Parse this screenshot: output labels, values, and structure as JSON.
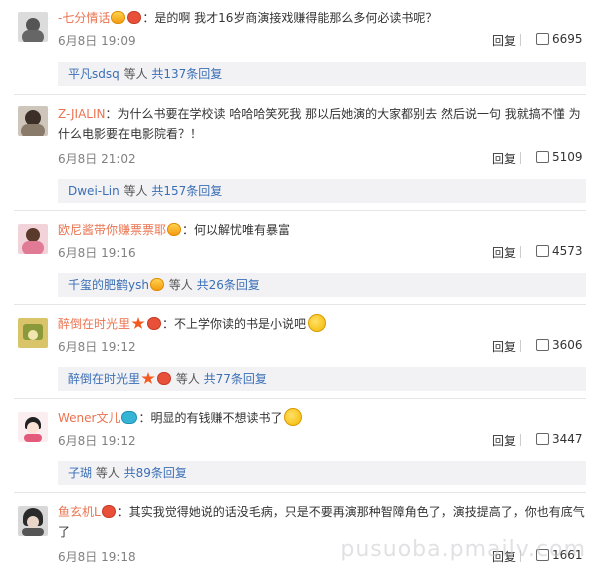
{
  "comments": [
    {
      "user": "-七分情话",
      "text": "：是的啊 我才16岁商演接戏赚得能那么多何必读书呢？",
      "date": "6月8日 19:09",
      "reply": "回复",
      "likes": "6695",
      "sub": {
        "user": "平凡sdsq",
        "mid": " 等人 ",
        "count": "共137条回复"
      },
      "avatar_color": "#e8e8e8"
    },
    {
      "user": "Z-JIALIN",
      "text": "：为什么书要在学校读 哈哈哈笑死我  那以后她演的大家都别去 然后说一句 我就搞不懂  为什么电影要在电影院看？！",
      "date": "6月8日 21:02",
      "reply": "回复",
      "likes": "5109",
      "sub": {
        "user": "Dwei-Lin",
        "mid": " 等人 ",
        "count": "共157条回复"
      },
      "avatar_color": "#7a6a5c"
    },
    {
      "user": "欧尼酱带你赚票票耶",
      "text": "：何以解忧唯有暴富",
      "date": "6月8日 19:16",
      "reply": "回复",
      "likes": "4573",
      "sub": {
        "user": "千玺的肥鹤ysh",
        "mid": " 等人 ",
        "count": "共26条回复"
      },
      "avatar_color": "#e9a6b4"
    },
    {
      "user": "醉倒在时光里",
      "text": "：不上学你读的书是小说吧",
      "date": "6月8日 19:12",
      "reply": "回复",
      "likes": "3606",
      "sub": {
        "user": "醉倒在时光里",
        "mid": " 等人 ",
        "count": "共77条回复"
      },
      "avatar_color": "#c6b25a"
    },
    {
      "user": "Wener文儿",
      "text": "：明显的有钱赚不想读书了",
      "date": "6月8日 19:12",
      "reply": "回复",
      "likes": "3447",
      "sub": {
        "user": "子瑚",
        "mid": " 等人 ",
        "count": "共89条回复"
      },
      "avatar_color": "#f4e0e4"
    },
    {
      "user": "鱼玄机L",
      "text": "：其实我觉得她说的话没毛病，只是不要再演那种智障角色了，演技提高了，你也有底气了",
      "date": "6月8日 19:18",
      "reply": "回复",
      "likes": "1661",
      "avatar_color": "#4a4a4a"
    }
  ],
  "watermark": "pusuoba.pmailv.com"
}
